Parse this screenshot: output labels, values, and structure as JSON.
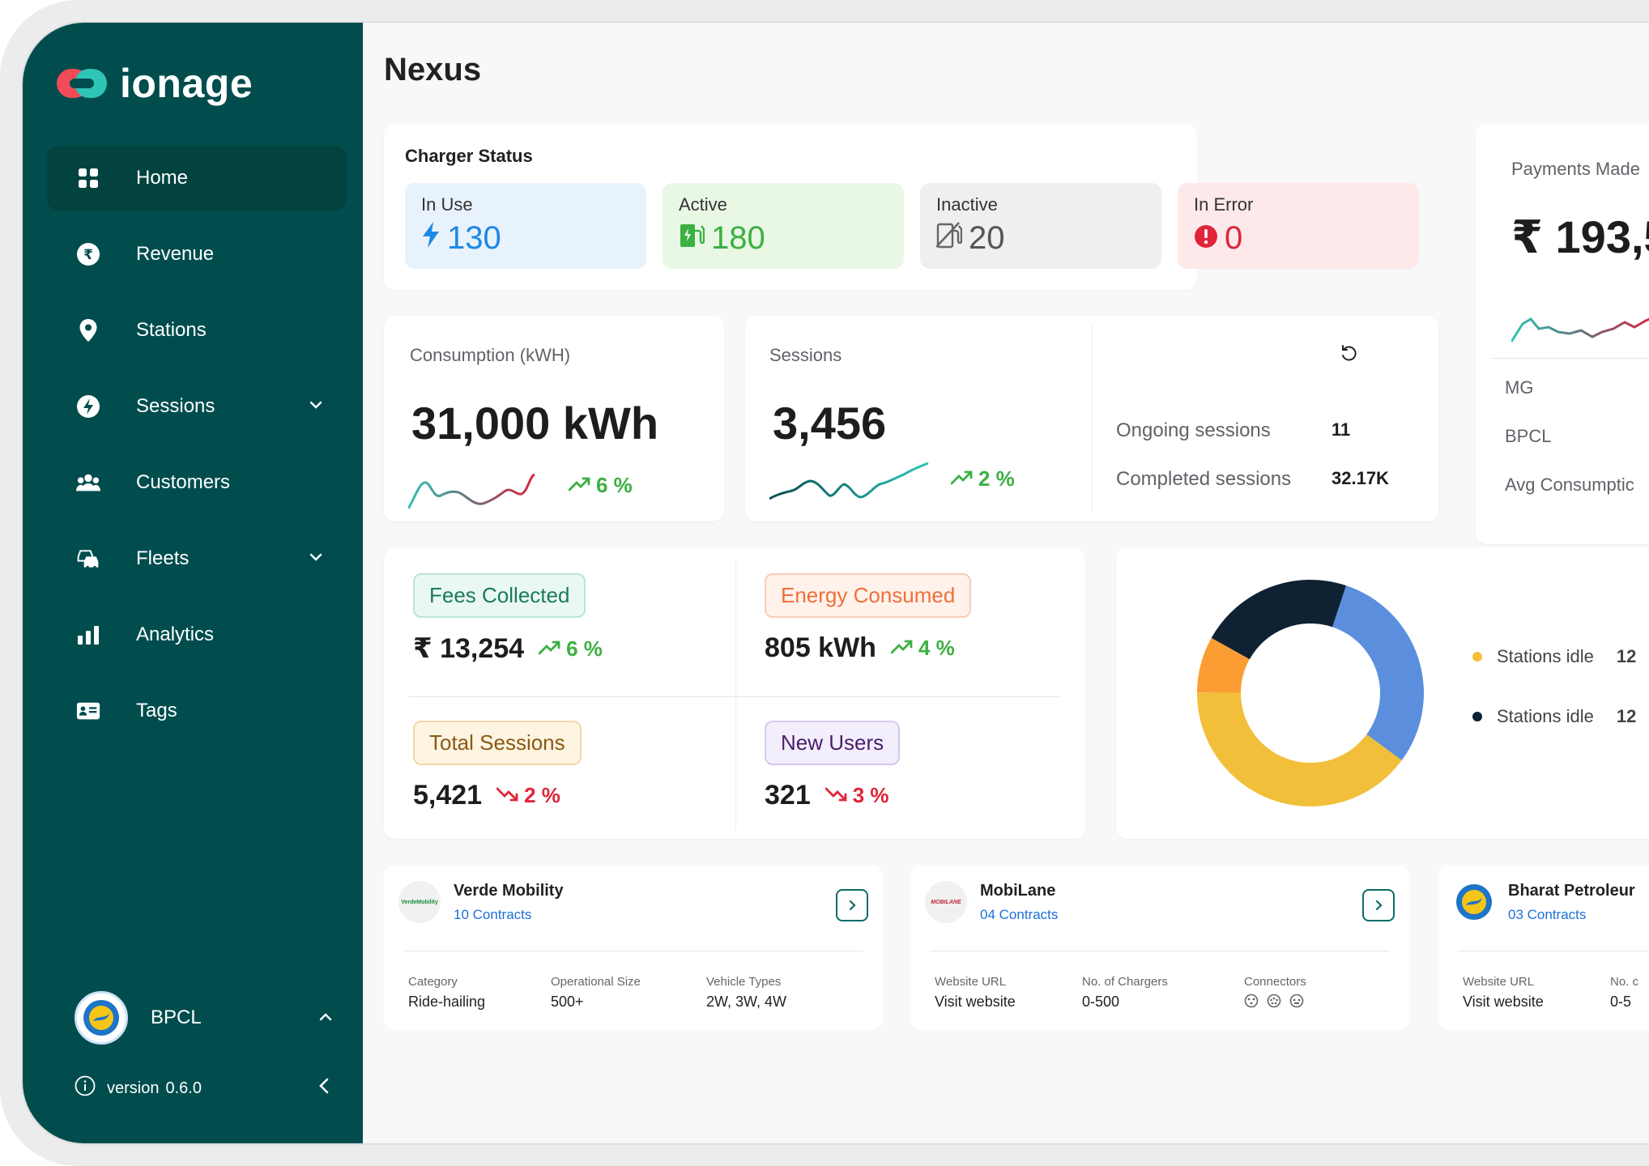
{
  "brand": {
    "name": "ionage"
  },
  "sidebar": {
    "items": [
      {
        "label": "Home",
        "icon": "grid-icon",
        "active": true
      },
      {
        "label": "Revenue",
        "icon": "rupee-icon"
      },
      {
        "label": "Stations",
        "icon": "location-pin-icon"
      },
      {
        "label": "Sessions",
        "icon": "bolt-circle-icon",
        "expandable": true
      },
      {
        "label": "Customers",
        "icon": "users-icon"
      },
      {
        "label": "Fleets",
        "icon": "cars-icon",
        "expandable": true
      },
      {
        "label": "Analytics",
        "icon": "bar-chart-icon"
      },
      {
        "label": "Tags",
        "icon": "id-card-icon"
      }
    ],
    "profile": {
      "name": "BPCL"
    },
    "version": {
      "label": "version",
      "value": "0.6.0"
    }
  },
  "page": {
    "title": "Nexus"
  },
  "charger_status": {
    "title": "Charger Status",
    "tiles": [
      {
        "label": "In Use",
        "value": "130",
        "color": "#1e88e5",
        "bg": "#e8f2fd"
      },
      {
        "label": "Active",
        "value": "180",
        "color": "#3cb043",
        "bg": "#e9f7e5"
      },
      {
        "label": "Inactive",
        "value": "20",
        "color": "#555555",
        "bg": "#efefef"
      },
      {
        "label": "In Error",
        "value": "0",
        "color": "#e0243a",
        "bg": "#fde8ea"
      }
    ]
  },
  "payments": {
    "title": "Payments Made",
    "value": "₹ 193,5",
    "rows": [
      "MG",
      "BPCL",
      "Avg Consumptic"
    ]
  },
  "consumption": {
    "title": "Consumption (kWH)",
    "value": "31,000 kWh",
    "trend": "6 %"
  },
  "sessions": {
    "title": "Sessions",
    "value": "3,456",
    "trend": "2 %",
    "ongoing_label": "Ongoing sessions",
    "ongoing_value": "11",
    "completed_label": "Completed sessions",
    "completed_value": "32.17K"
  },
  "kpis": {
    "fees": {
      "label": "Fees Collected",
      "value": "₹ 13,254",
      "trend": "6 %"
    },
    "energy": {
      "label": "Energy Consumed",
      "value": "805 kWh",
      "trend": "4 %"
    },
    "total_sessions": {
      "label": "Total Sessions",
      "value": "5,421",
      "trend": "2 %"
    },
    "new_users": {
      "label": "New Users",
      "value": "321",
      "trend": "3 %"
    }
  },
  "donut": {
    "legend": [
      {
        "label": "Stations idle",
        "value": "12",
        "color": "#f2bf3b"
      },
      {
        "label": "Stations idle",
        "value": "12",
        "color": "#0f2233"
      }
    ]
  },
  "chart_data": {
    "type": "pie",
    "variant": "donut",
    "series": [
      {
        "name": "",
        "values": [
          30,
          40,
          8,
          22
        ]
      }
    ],
    "colors": [
      "#5b8fde",
      "#f2bf3b",
      "#fb9d33",
      "#0f2233"
    ]
  },
  "companies": [
    {
      "name": "Verde Mobility",
      "contracts": "10 Contracts",
      "logo_text": "VerdeMobility",
      "fields": [
        {
          "k": "Category",
          "v": "Ride-hailing"
        },
        {
          "k": "Operational Size",
          "v": "500+"
        },
        {
          "k": "Vehicle Types",
          "v": "2W, 3W, 4W"
        }
      ]
    },
    {
      "name": "MobiLane",
      "contracts": "04 Contracts",
      "logo_text": "MOBILANE",
      "fields": [
        {
          "k": "Website URL",
          "v": "Visit website"
        },
        {
          "k": "No. of Chargers",
          "v": "0-500"
        },
        {
          "k": "Connectors",
          "v": ""
        }
      ]
    },
    {
      "name": "Bharat Petroleur",
      "contracts": "03 Contracts",
      "logo_text": "",
      "fields": [
        {
          "k": "Website URL",
          "v": "Visit website"
        },
        {
          "k": "No. c",
          "v": "0-5"
        }
      ]
    }
  ]
}
